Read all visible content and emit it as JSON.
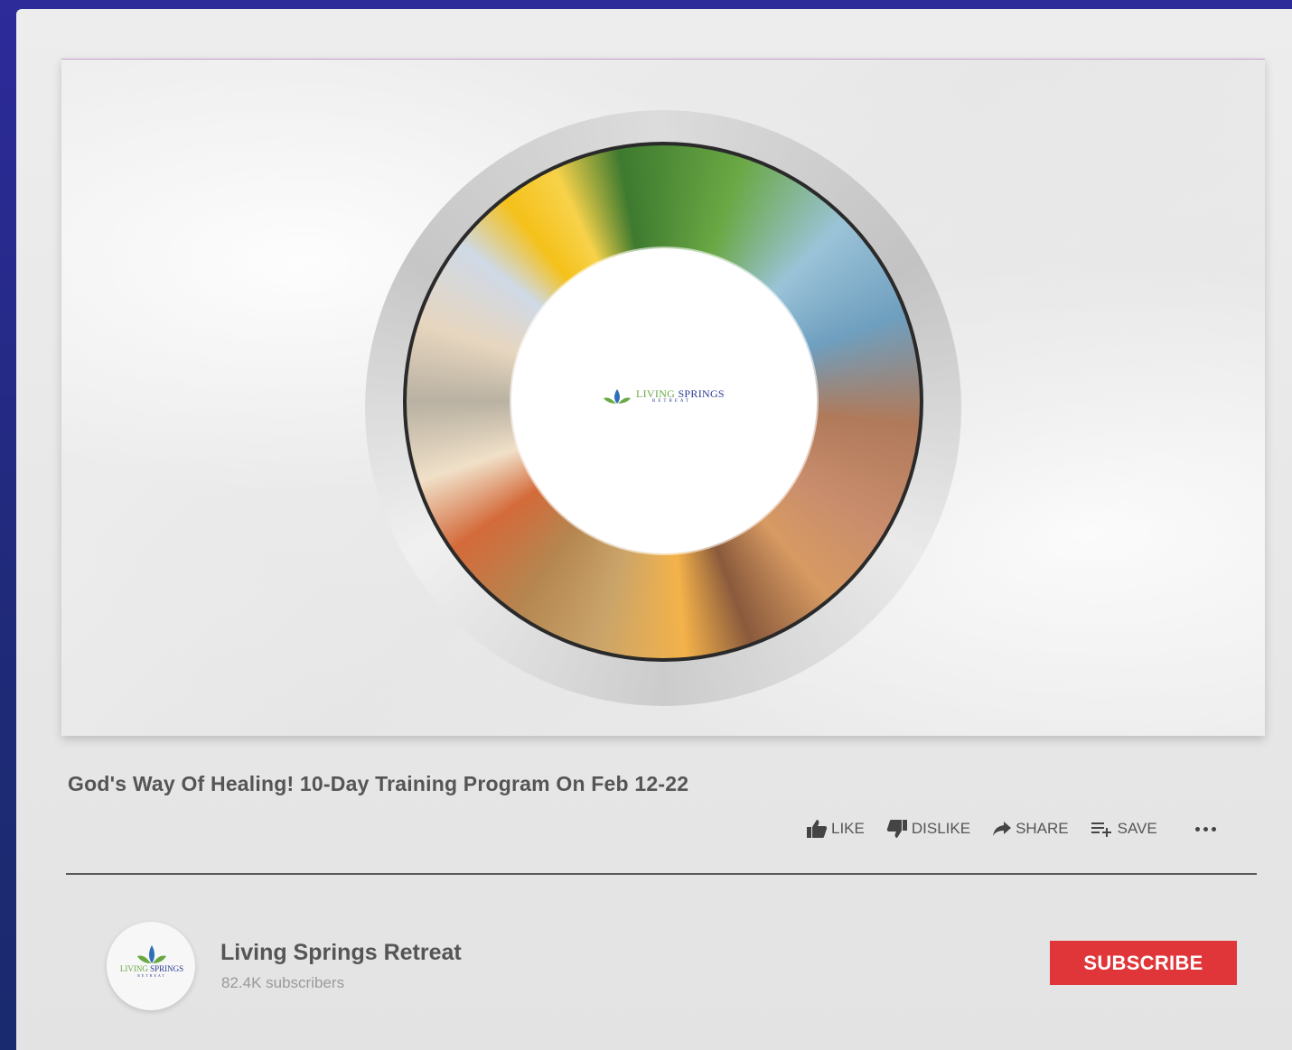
{
  "video": {
    "logo_main_a": "LIVING",
    "logo_main_b": "SPRINGS",
    "logo_sub": "RETREAT"
  },
  "title": "God's Way Of Healing! 10-Day Training Program On Feb 12-22",
  "actions": {
    "like": "LIKE",
    "dislike": "DISLIKE",
    "share": "SHARE",
    "save": "SAVE"
  },
  "channel": {
    "avatar_main_a": "LIVING",
    "avatar_main_b": "SPRINGS",
    "avatar_sub": "RETREAT",
    "name": "Living Springs Retreat",
    "subscribers": "82.4K subscribers"
  },
  "subscribe_label": "SUBSCRIBE",
  "colors": {
    "subscribe": "#e0363a",
    "brand_blue": "#2b3b8f",
    "brand_green": "#6aa844"
  },
  "icons": {
    "like": "thumbs-up-icon",
    "dislike": "thumbs-down-icon",
    "share": "share-arrow-icon",
    "save": "playlist-add-icon",
    "more": "more-horizontal-icon"
  }
}
